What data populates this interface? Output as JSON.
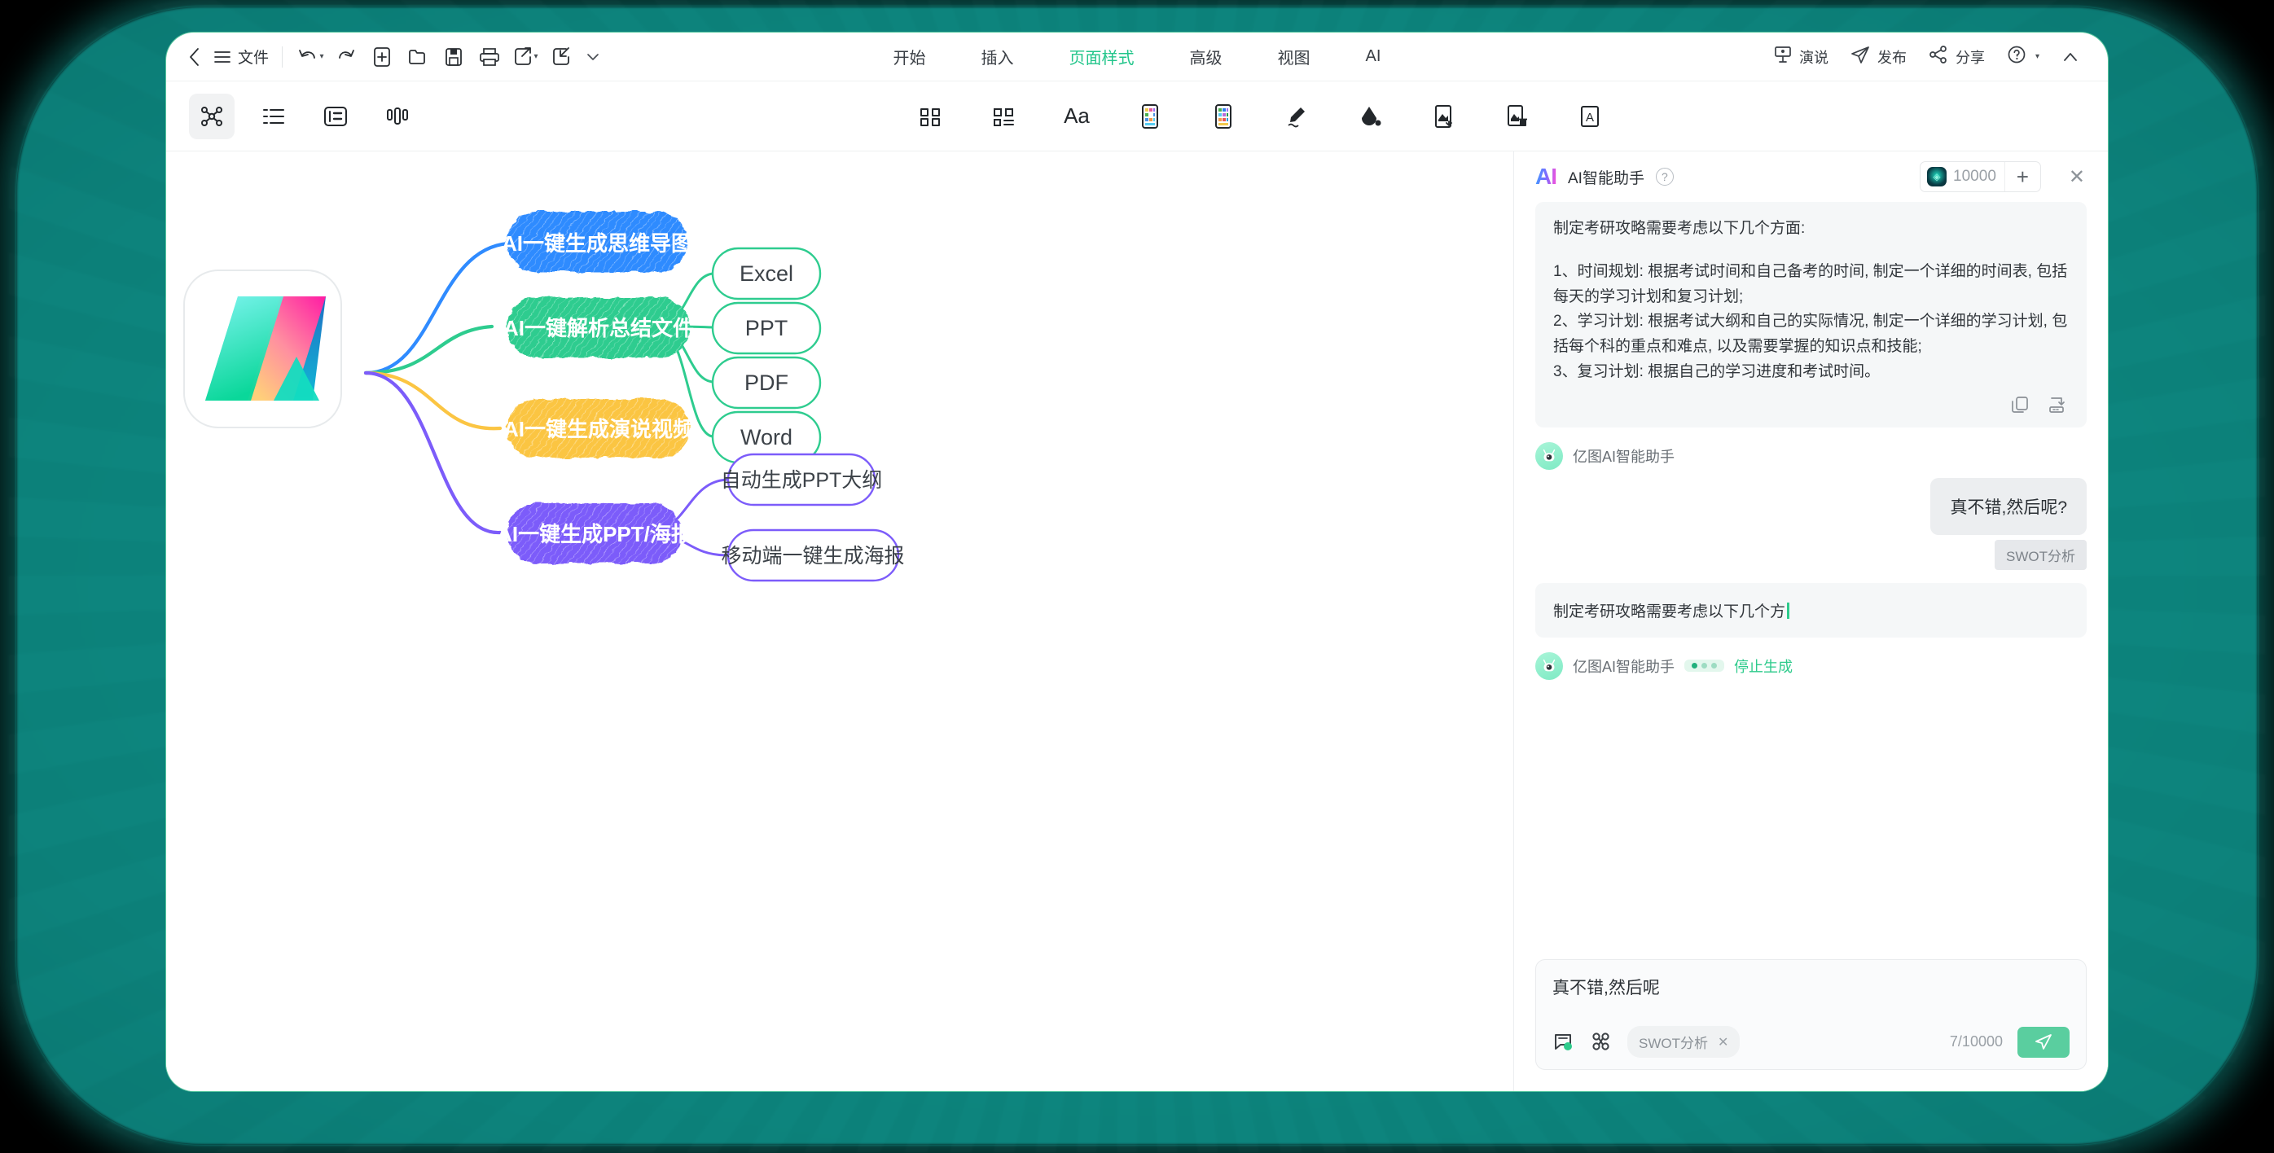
{
  "menubar": {
    "back_icon": "chevron-left-icon",
    "file_menu_icon": "hamburger-icon",
    "file_label": "文件",
    "quick_tools": [
      {
        "name": "undo-icon",
        "glyph": "undo",
        "has_caret": true
      },
      {
        "name": "redo-icon",
        "glyph": "redo",
        "has_caret": false
      },
      {
        "name": "new-icon",
        "glyph": "new",
        "has_caret": false
      },
      {
        "name": "open-icon",
        "glyph": "open",
        "has_caret": false
      },
      {
        "name": "save-icon",
        "glyph": "save",
        "has_caret": false
      },
      {
        "name": "print-icon",
        "glyph": "print",
        "has_caret": false
      },
      {
        "name": "export-icon",
        "glyph": "export",
        "has_caret": true
      },
      {
        "name": "import-icon",
        "glyph": "import",
        "has_caret": false
      },
      {
        "name": "more-icon",
        "glyph": "chevron-down",
        "has_caret": false
      }
    ],
    "tabs": [
      {
        "label": "开始",
        "active": false
      },
      {
        "label": "插入",
        "active": false
      },
      {
        "label": "页面样式",
        "active": true
      },
      {
        "label": "高级",
        "active": false
      },
      {
        "label": "视图",
        "active": false
      },
      {
        "label": "AI",
        "active": false
      }
    ],
    "right_items": [
      {
        "label": "演说",
        "icon": "presentation-icon"
      },
      {
        "label": "发布",
        "icon": "paper-plane-icon"
      },
      {
        "label": "分享",
        "icon": "share-nodes-icon"
      }
    ],
    "help_icon": "question-circle-icon",
    "collapse_icon": "chevron-up-icon"
  },
  "toolbar": {
    "left_tools": [
      {
        "name": "mindmap-layout-icon",
        "selected": true
      },
      {
        "name": "outline-list-icon",
        "selected": false
      },
      {
        "name": "layout-panel-icon",
        "selected": false
      },
      {
        "name": "columns-icon",
        "selected": false
      }
    ],
    "center_tools": [
      {
        "name": "grid-layout-icon"
      },
      {
        "name": "grid-list-icon"
      },
      {
        "name": "font-icon",
        "text": "Aa"
      },
      {
        "name": "theme-color-icon"
      },
      {
        "name": "theme-palette-icon"
      },
      {
        "name": "pen-style-icon"
      },
      {
        "name": "fill-color-icon"
      },
      {
        "name": "background-image-icon"
      },
      {
        "name": "remove-background-icon"
      },
      {
        "name": "watermark-icon",
        "text": "A"
      }
    ]
  },
  "mindmap": {
    "root": {
      "name": "app-logo-node",
      "label": ""
    },
    "branches": [
      {
        "label": "AI一键生成思维导图",
        "color": "#2f8bff",
        "text_color": "#ffffff",
        "children": []
      },
      {
        "label": "AI一键解析总结文件",
        "color": "#2ecc8f",
        "text_color": "#ffffff",
        "children": [
          "Excel",
          "PPT",
          "PDF",
          "Word"
        ]
      },
      {
        "label": "AI一键生成演说视频",
        "color": "#fbc martial",
        "text_color": "#ffffff",
        "children": []
      },
      {
        "label": "AI一键生成PPT/海报",
        "color": "#7c5cfa",
        "text_color": "#ffffff",
        "children": [
          "自动生成PPT大纲",
          "移动端一键生成海报"
        ]
      }
    ]
  },
  "ai_panel": {
    "logo_text": "AI",
    "title": "AI智能助手",
    "help_icon": "question-circle-icon",
    "credits_value": "10000",
    "credits_add_icon": "plus-icon",
    "close_icon": "close-icon",
    "messages": {
      "answer_intro": "制定考研攻略需要考虑以下几个方面:",
      "answer_point_1": "1、时间规划: 根据考试时间和自己备考的时间, 制定一个详细的时间表, 包括每天的学习计划和复习计划;",
      "answer_point_2": "2、学习计划: 根据考试大纲和自己的实际情况, 制定一个详细的学习计划, 包括每个科的重点和难点, 以及需要掌握的知识点和技能;",
      "answer_point_3": "3、复习计划: 根据自己的学习进度和考试时间。",
      "copy_icon": "copy-icon",
      "insert_icon": "insert-to-canvas-icon",
      "bot_name_1": "亿图AI智能助手",
      "user_message": "真不错,然后呢?",
      "user_tag": "SWOT分析",
      "streaming_text": "制定考研攻略需要考虑以下几个方",
      "bot_name_2": "亿图AI智能助手",
      "stop_label": "停止生成"
    },
    "composer": {
      "value": "真不错,然后呢",
      "template_icon": "template-icon",
      "role_icon": "role-icon",
      "chip_label": "SWOT分析",
      "chip_close_icon": "close-icon",
      "counter": "7/10000",
      "send_icon": "send-icon"
    }
  },
  "colors": {
    "accent_green": "#2ecb8c",
    "tab_active": "#21c58a",
    "branch_blue": "#2f8bff",
    "branch_green": "#2ecc8f",
    "branch_yellow": "#fbc543",
    "branch_purple": "#7c5cfa",
    "backdrop_teal": "#0f8e86",
    "send_button": "#5ace9f"
  }
}
